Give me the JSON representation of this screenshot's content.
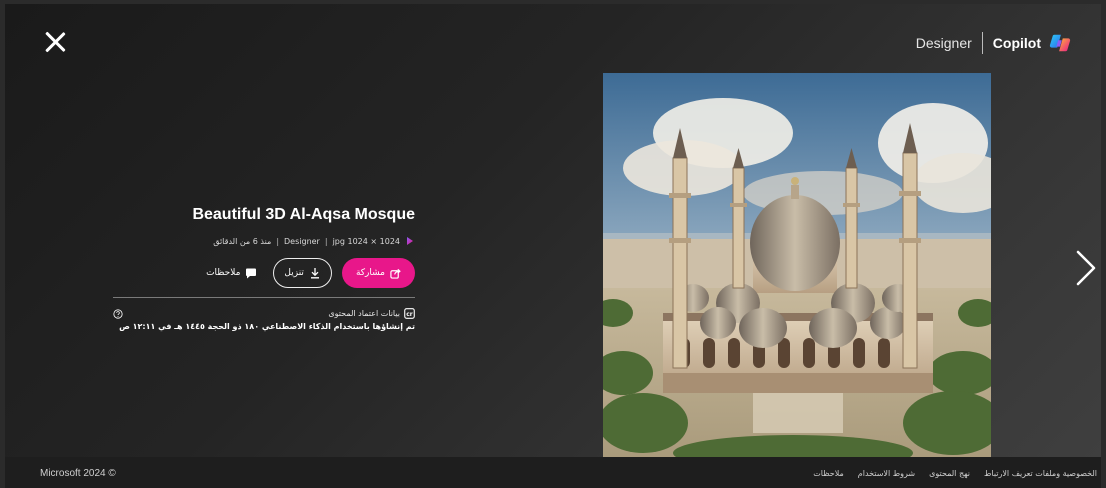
{
  "header": {
    "designer_label": "Designer",
    "copilot_label": "Copilot"
  },
  "image": {
    "title": "Beautiful 3D Al-Aqsa Mosque"
  },
  "meta": {
    "format": "jpg 1024 × 1024",
    "separator": "|",
    "source": "Designer",
    "age": "منذ 6 من الدقائق"
  },
  "actions": {
    "share_label": "مشاركة",
    "download_label": "تنزيل",
    "feedback_label": "ملاحظات"
  },
  "credentials": {
    "label": "بيانات اعتماد المحتوى",
    "detail": "تم إنشاؤها باستخدام الذكاء الاصطناعي ١٨٠ ذو الحجة ١٤٤٥ هـ في ١٢:١١ ص"
  },
  "footer": {
    "copyright": "Microsoft 2024 ©",
    "links": [
      "الخصوصية وملفات تعريف الارتباط",
      "نهج المحتوى",
      "شروط الاستخدام",
      "ملاحظات"
    ]
  },
  "colors": {
    "accent": "#e8178a",
    "background": "#2b2b2b",
    "footer": "#1e1e1e"
  }
}
